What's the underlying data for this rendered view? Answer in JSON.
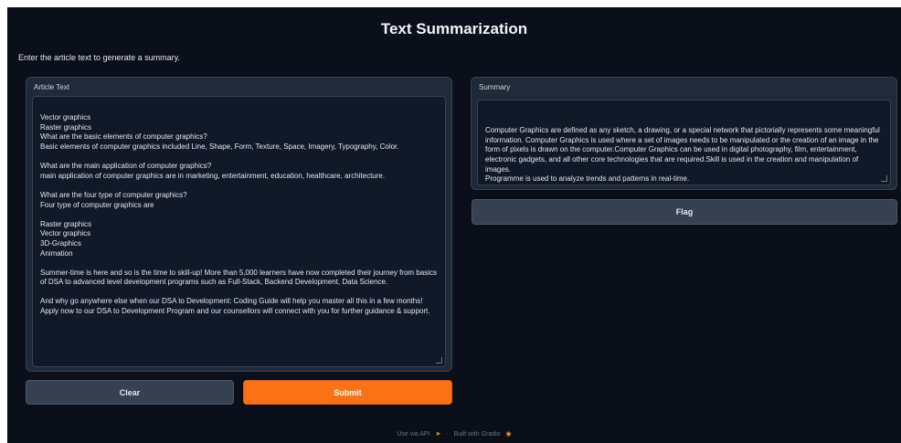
{
  "header": {
    "title": "Text Summarization",
    "description": "Enter the article text to generate a summary."
  },
  "input_panel": {
    "label": "Article Text",
    "value": "Vector graphics\nRaster graphics\nWhat are the basic elements of computer graphics?\nBasic elements of computer graphics included Line, Shape, Form, Texture, Space, Imagery, Typography, Color.\n\nWhat are the main application of computer graphics?\nmain application of computer graphics are in marketing, entertainment, education, healthcare, architecture.\n\nWhat are the four type of computer graphics?\nFour type of computer graphics are\n\nRaster graphics\nVector graphics\n3D-Graphics\nAnimation\n\nSummer-time is here and so is the time to skill-up! More than 5,000 learners have now completed their journey from basics of DSA to advanced level development programs such as Full-Stack, Backend Development, Data Science.\n\nAnd why go anywhere else when our DSA to Development: Coding Guide will help you master all this in a few months! Apply now to our DSA to Development Program and our counsellors will connect with you for further guidance & support."
  },
  "output_panel": {
    "label": "Summary",
    "value": "Computer Graphics are defined as any sketch, a drawing, or a special network that pictorially represents some meaningful information. Computer Graphics is used where a set of images needs to be manipulated or the creation of an image in the form of pixels is drawn on the computer.Computer Graphics can be used in digital photography, film, entertainment, electronic gadgets, and all other core technologies that are required.Skill is used in the creation and manipulation of images.\nProgramme is used to analyze trends and patterns in real-time."
  },
  "buttons": {
    "clear": "Clear",
    "submit": "Submit",
    "flag": "Flag"
  },
  "footer": {
    "api_link": "Use via API",
    "separator": "·",
    "built_with": "Built with Gradio"
  }
}
